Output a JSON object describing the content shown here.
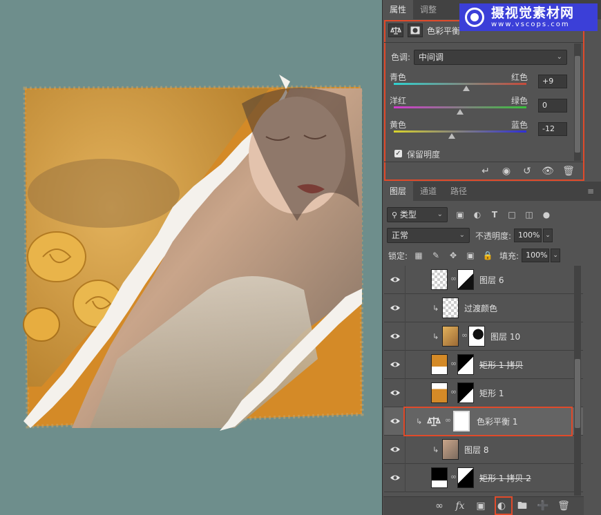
{
  "properties_panel": {
    "tabs": [
      "属性",
      "调整"
    ],
    "title": "色彩平衡",
    "tone_label": "色调:",
    "tone_value": "中间调",
    "sliders": [
      {
        "left": "青色",
        "right": "红色",
        "value": "+9",
        "level": 0.545
      },
      {
        "left": "洋红",
        "right": "绿色",
        "value": "0",
        "level": 0.5
      },
      {
        "left": "黄色",
        "right": "蓝色",
        "value": "-12",
        "level": 0.44
      }
    ],
    "preserve_luminosity": "保留明度",
    "preserve_checked": true
  },
  "layers_panel": {
    "tabs": [
      "图层",
      "通道",
      "路径"
    ],
    "filter_kind": "类型",
    "blend_mode": "正常",
    "opacity_label": "不透明度:",
    "opacity_value": "100%",
    "lock_label": "锁定:",
    "fill_label": "填充:",
    "fill_value": "100%",
    "layers": [
      {
        "name": "图层 6",
        "clipped": false,
        "strike": false
      },
      {
        "name": "过渡颜色",
        "clipped": true,
        "strike": false
      },
      {
        "name": "图层 10",
        "clipped": true,
        "strike": false
      },
      {
        "name": "矩形 1 拷贝",
        "clipped": false,
        "strike": true
      },
      {
        "name": "矩形 1",
        "clipped": false,
        "strike": false
      },
      {
        "name": "色彩平衡 1",
        "clipped": true,
        "strike": false,
        "selected": true
      },
      {
        "name": "图层 8",
        "clipped": true,
        "strike": false
      },
      {
        "name": "矩形 1 拷贝 2",
        "clipped": false,
        "strike": true
      }
    ]
  },
  "watermark": {
    "title": "摄视觉素材网",
    "url": "www.vscops.com"
  },
  "colors": {
    "canvas_bg": "#6e8e8c",
    "panel_bg": "#535353",
    "highlight": "#e14a2a",
    "orange": "#d48a27",
    "watermark_bg": "#3b3fd8"
  }
}
